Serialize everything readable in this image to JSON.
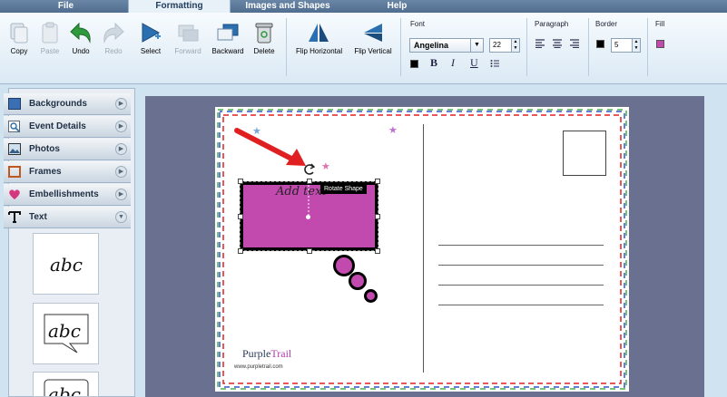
{
  "tabs": [
    {
      "label": "File",
      "active": false
    },
    {
      "label": "Formatting",
      "active": true
    },
    {
      "label": "Images and Shapes",
      "active": false
    },
    {
      "label": "Help",
      "active": false
    }
  ],
  "toolbar": {
    "copy": "Copy",
    "paste": "Paste",
    "undo": "Undo",
    "redo": "Redo",
    "select": "Select",
    "forward": "Forward",
    "backward": "Backward",
    "delete": "Delete",
    "flip_horizontal": "Flip Horizontal",
    "flip_vertical": "Flip Vertical"
  },
  "font_group": {
    "title": "Font",
    "font_name": "Angelina",
    "font_size": "22",
    "bold": "B",
    "italic": "I",
    "underline": "U"
  },
  "paragraph_group": {
    "title": "Paragraph"
  },
  "border_group": {
    "title": "Border",
    "width": "5"
  },
  "fill_group": {
    "title": "Fill",
    "color": "#c24aaf"
  },
  "sidebar": {
    "items": [
      {
        "label": "Backgrounds",
        "icon": "backgrounds-icon"
      },
      {
        "label": "Event Details",
        "icon": "magnifier-icon"
      },
      {
        "label": "Photos",
        "icon": "photo-icon"
      },
      {
        "label": "Frames",
        "icon": "frame-icon"
      },
      {
        "label": "Embellishments",
        "icon": "heart-icon"
      },
      {
        "label": "Text",
        "icon": "text-icon"
      }
    ],
    "text_samples": [
      "abc",
      "abc",
      "abc"
    ]
  },
  "canvas": {
    "placeholder_text": "Add text",
    "tooltip": "Rotate Shape",
    "logo_purple": "Purple",
    "logo_trail": "Trail",
    "url": "www.purpletrail.com"
  },
  "colors": {
    "accent": "#c24aaf",
    "canvas_bg": "#6a7190",
    "border_red": "#e02020",
    "border_blue": "#3355cc",
    "border_green": "#4caf50"
  }
}
